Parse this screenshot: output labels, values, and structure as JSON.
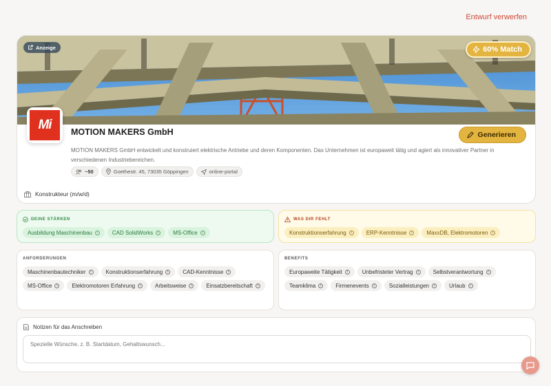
{
  "header": {
    "discard_label": "Entwurf verwerfen"
  },
  "hero": {
    "ad_label": "Anzeige",
    "match_label": "60% Match"
  },
  "company": {
    "logo_text": "Mi",
    "name": "MOTION MAKERS GmbH",
    "generate_label": "Generieren",
    "description": "MOTION MAKERS GmbH entwickelt und konstruiert elektrische Antriebe und deren Komponenten. Das Unternehmen ist europaweit tätig und agiert als innovativer Partner in verschiedenen Industriebereichen.",
    "employees": "~50",
    "address": "Goethestr. 45, 73035 Göppingen",
    "source": "online-portal",
    "role": "Konstrukteur (m/w/d)"
  },
  "strengths": {
    "title": "DEINE STÄRKEN",
    "items": [
      "Ausbildung Maschinenbau",
      "CAD SolidWorks",
      "MS-Office"
    ]
  },
  "missing": {
    "title": "WAS DIR FEHLT",
    "items": [
      "Konstruktionserfahrung",
      "ERP-Kenntnisse",
      "MaxxDB, Elektromotoren"
    ]
  },
  "requirements": {
    "title": "ANFORDERUNGEN",
    "items": [
      "Maschinenbautechniker",
      "Konstruktionserfahrung",
      "CAD-Kenntnisse",
      "MS-Office",
      "Elektromotoren Erfahrung",
      "Arbeitsweise",
      "Einsatzbereitschaft"
    ]
  },
  "benefits": {
    "title": "BENEFITS",
    "items": [
      "Europaweite Tätigkeit",
      "Unbefristeter Vertrag",
      "Selbstverantwortung",
      "Teamklima",
      "Firmenevents",
      "Sozialleistungen",
      "Urlaub"
    ]
  },
  "notes": {
    "title": "Notizen für das Anschreiben",
    "placeholder": "Spezielle Wünsche, z. B. Startdatum, Gehaltswunsch..."
  },
  "colors": {
    "accent": "#e3b43f",
    "danger": "#d0473a",
    "success": "#2f8a45",
    "logo_bg": "#e0311f"
  }
}
